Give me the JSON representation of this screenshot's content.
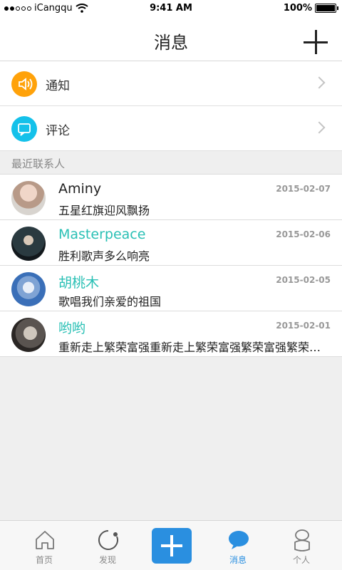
{
  "status_bar": {
    "carrier": "iCangqu",
    "time": "9:41 AM",
    "battery": "100%"
  },
  "header": {
    "title": "消息"
  },
  "menu": [
    {
      "label": "通知",
      "icon": "speaker-icon",
      "color": "#ffa20a"
    },
    {
      "label": "评论",
      "icon": "comment-icon",
      "color": "#14c1ea"
    }
  ],
  "section": {
    "title": "最近联系人"
  },
  "contacts": [
    {
      "name": "Aminy",
      "message": "五星红旗迎风飘扬",
      "date": "2015-02-07",
      "name_color": "#222222"
    },
    {
      "name": "Masterpeace",
      "message": "胜利歌声多么响亮",
      "date": "2015-02-06",
      "name_color": "#2ac0b5"
    },
    {
      "name": "胡桃木",
      "message": "歌唱我们亲爱的祖国",
      "date": "2015-02-05",
      "name_color": "#2ac0b5"
    },
    {
      "name": "哟哟",
      "message": "重新走上繁荣富强重新走上繁荣富强繁荣富强繁荣富强",
      "date": "2015-02-01",
      "name_color": "#2ac0b5"
    }
  ],
  "tab_bar": {
    "tabs": [
      {
        "label": "首页",
        "icon": "home-icon"
      },
      {
        "label": "发现",
        "icon": "discover-icon"
      },
      {
        "label": "",
        "icon": "plus-icon"
      },
      {
        "label": "消息",
        "icon": "message-icon",
        "active": true
      },
      {
        "label": "个人",
        "icon": "person-icon"
      }
    ]
  }
}
